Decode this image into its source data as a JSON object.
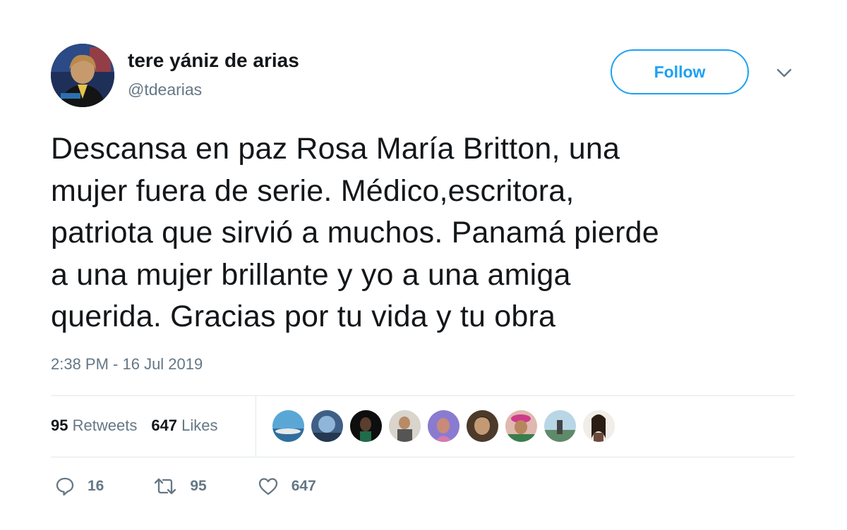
{
  "user": {
    "name": "tere yániz de arias",
    "handle": "@tdearias"
  },
  "follow_label": "Follow",
  "tweet": {
    "text": "Descansa en paz Rosa María Britton, una\nmujer fuera de serie. Médico,escritora,\npatriota que sirvió a muchos. Panamá pierde\na una mujer brillante y yo a una amiga\nquerida. Gracias por tu vida y tu obra",
    "timestamp": "2:38 PM - 16 Jul 2019"
  },
  "stats": {
    "retweets_count": "95",
    "retweets_label": "Retweets",
    "likes_count": "647",
    "likes_label": "Likes"
  },
  "liked_by_avatars": 9,
  "actions": {
    "replies": "16",
    "retweets": "95",
    "likes": "647"
  },
  "colors": {
    "accent": "#1da1f2",
    "secondary_text": "#657786",
    "divider": "#e1e8ed"
  },
  "icons": [
    "chevron-down-icon",
    "reply-icon",
    "retweet-icon",
    "heart-icon"
  ]
}
